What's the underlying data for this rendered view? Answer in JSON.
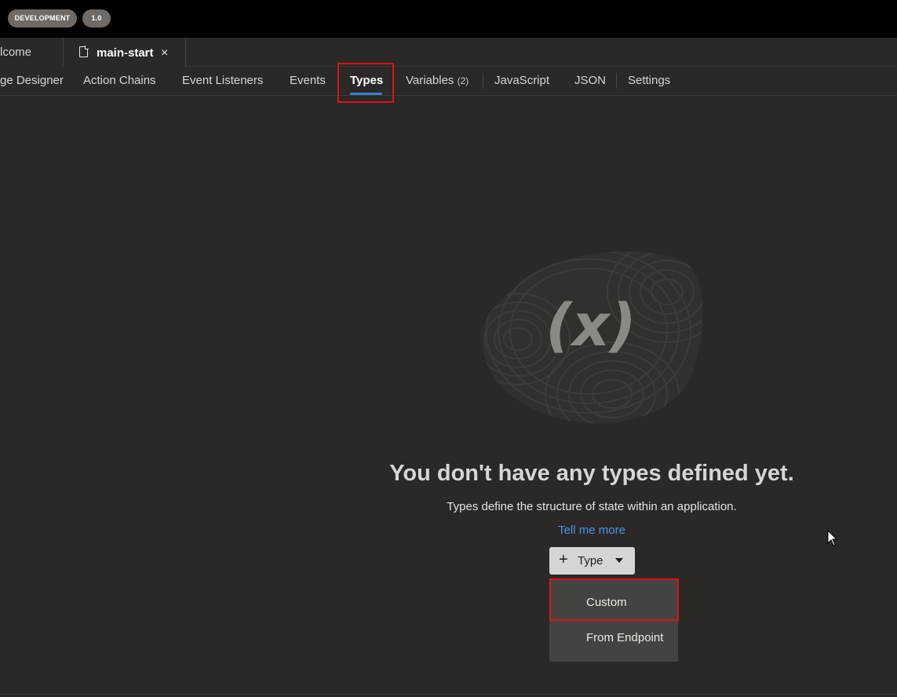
{
  "topbar": {
    "env_badge": "DEVELOPMENT",
    "version_badge": "1.0"
  },
  "file_tabs": {
    "welcome": "lcome",
    "main": "main-start",
    "close_glyph": "×"
  },
  "designer_tabs": [
    {
      "label": "ge Designer"
    },
    {
      "label": "Action Chains"
    },
    {
      "label": "Event Listeners"
    },
    {
      "label": "Events"
    },
    {
      "label": "Types",
      "active": true
    },
    {
      "label": "Variables",
      "count": "(2)"
    },
    {
      "label": "JavaScript"
    },
    {
      "label": "JSON"
    },
    {
      "label": "Settings"
    }
  ],
  "empty_state": {
    "icon_text": "(x)",
    "title": "You don't have any types defined yet.",
    "description": "Types define the structure of state within an application.",
    "link": "Tell me more"
  },
  "type_button": {
    "plus": "+",
    "label": "Type"
  },
  "dropdown": {
    "items": [
      {
        "label": "Custom"
      },
      {
        "label": "From Endpoint"
      }
    ]
  },
  "colors": {
    "background": "#2b2826",
    "accent": "#3a7bd5",
    "link": "#4f93ea",
    "highlight": "#d8141e"
  }
}
